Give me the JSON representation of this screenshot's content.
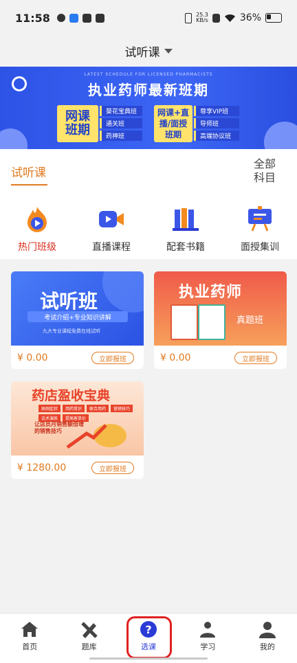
{
  "status_bar": {
    "time": "11:58",
    "speed_top": "25.3",
    "speed_bottom": "KB/s",
    "battery": "36%"
  },
  "header": {
    "title": "试听课"
  },
  "banner": {
    "subtitle": "LATEST SCHEDULE FOR LICENSED PHARMACISTS",
    "title": "执业药师最新班期",
    "group1": {
      "line1": "网课",
      "line2": "班期",
      "classes": [
        "葵花宝典班",
        "通关班",
        "药神班"
      ]
    },
    "group2": {
      "line1": "网课+直",
      "line2": "播/面授",
      "line3": "班期",
      "classes": [
        "尊享VIP班",
        "导师班",
        "高端协议班"
      ]
    }
  },
  "tabs": {
    "active": "试听课",
    "all_line1": "全部",
    "all_line2": "科目"
  },
  "categories": [
    {
      "label": "热门班级",
      "icon": "flame-icon"
    },
    {
      "label": "直播课程",
      "icon": "video-camera-icon"
    },
    {
      "label": "配套书籍",
      "icon": "books-icon"
    },
    {
      "label": "面授集训",
      "icon": "presentation-board-icon"
    }
  ],
  "courses": [
    {
      "title": "试听班",
      "tagline": "考试介绍+专业知识讲解",
      "note": "九大专业课程免费在线试听",
      "price": "¥ 0.00",
      "button": "立即报班"
    },
    {
      "title": "执业药师",
      "tag": "真题班",
      "price": "¥ 0.00",
      "button": "立即报班"
    },
    {
      "title": "药店盈收宝典",
      "chips": [
        "病例症状",
        "用药常识",
        "联合用药",
        "营销技巧",
        "话术演练",
        "提高客单价"
      ],
      "caption_line1": "让店员月销售额倍增",
      "caption_line2": "的销售技巧",
      "price": "¥ 1280.00",
      "button": "立即报班"
    }
  ],
  "bottom_nav": [
    {
      "label": "首页",
      "icon": "home-icon"
    },
    {
      "label": "题库",
      "icon": "pencil-ruler-icon"
    },
    {
      "label": "选课",
      "icon": "question-icon"
    },
    {
      "label": "学习",
      "icon": "study-icon"
    },
    {
      "label": "我的",
      "icon": "user-icon"
    }
  ],
  "colors": {
    "accent": "#e07a1f",
    "nav_active": "#2a3bd6",
    "banner_blue": "#3d66f5"
  }
}
